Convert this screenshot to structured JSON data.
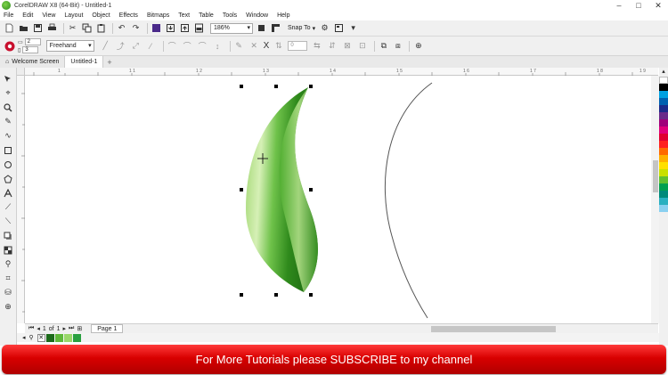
{
  "window": {
    "title": "CorelDRAW X8 (64-Bit) - Untitled-1",
    "controls": [
      "–",
      "□",
      "✕"
    ]
  },
  "menu": [
    "File",
    "Edit",
    "View",
    "Layout",
    "Object",
    "Effects",
    "Bitmaps",
    "Text",
    "Table",
    "Tools",
    "Window",
    "Help"
  ],
  "toolbar": {
    "zoom": "186%",
    "snap_label": "Snap To"
  },
  "property_bar": {
    "stepper_top": "2",
    "stepper_bottom": "3",
    "mode": "Freehand",
    "num_field": "0"
  },
  "tabs": {
    "welcome": "Welcome Screen",
    "document": "Untitled-1",
    "add": "+"
  },
  "ruler": {
    "top_labels": [
      "1",
      "1 1",
      "1 2",
      "1 3",
      "1 4",
      "1 5",
      "1 6",
      "1 7",
      "1 8",
      "1 9"
    ]
  },
  "page_nav": {
    "current": "1",
    "of": "of",
    "total": "1",
    "page_tab": "Page 1"
  },
  "colors": {
    "leaf_dark": "#2f8a1c",
    "leaf_mid": "#6fc24a",
    "leaf_light": "#d6f0b6",
    "banner": "#d80000",
    "palette": [
      "#ffffff",
      "#000000",
      "#00a0e0",
      "#0060b0",
      "#1c2a8a",
      "#6a2a8a",
      "#a0007a",
      "#e0007a",
      "#e00030",
      "#ff2020",
      "#ff6a00",
      "#ffb000",
      "#ffe000",
      "#c8e000",
      "#60c030",
      "#00a050",
      "#008a7a",
      "#2ab0c0",
      "#8ad0f0"
    ],
    "fill_swatches": [
      "#1c6a1a",
      "#5fb83a",
      "#9ad86a",
      "#2aa040"
    ]
  },
  "banner": {
    "text": "For More Tutorials please SUBSCRIBE to my channel"
  }
}
